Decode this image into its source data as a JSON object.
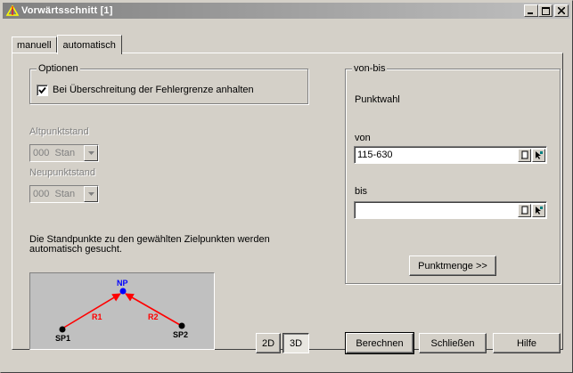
{
  "window": {
    "title": "Vorwärtsschnitt [1]"
  },
  "tabs": [
    {
      "label": "manuell",
      "active": false
    },
    {
      "label": "automatisch",
      "active": true
    }
  ],
  "optionen": {
    "legend": "Optionen",
    "checkbox_label": "Bei Überschreitung der Fehlergrenze anhalten",
    "checked": true
  },
  "altpunktstand": {
    "label": "Altpunktstand",
    "code": "000",
    "value": "Stan"
  },
  "neupunktstand": {
    "label": "Neupunktstand",
    "code": "000",
    "value": "Stan"
  },
  "info_text_line1": "Die Standpunkte zu den gewählten Zielpunkten werden",
  "info_text_line2": "automatisch gesucht.",
  "diagram": {
    "np": "NP",
    "r1": "R1",
    "r2": "R2",
    "sp1": "SP1",
    "sp2": "SP2",
    "colors": {
      "np": "#0000ff",
      "ray": "#ff0000",
      "point": "#000000",
      "bg": "#c0c0c0"
    }
  },
  "vonbis": {
    "legend": "von-bis",
    "punktwahl": "Punktwahl",
    "von_label": "von",
    "von_value": "115-630",
    "bis_label": "bis",
    "bis_value": "",
    "punktmenge_label": "Punktmenge >>"
  },
  "dim": {
    "two_d": "2D",
    "three_d": "3D",
    "active": "3D"
  },
  "footer": {
    "berechnen": "Berechnen",
    "schliessen": "Schließen",
    "hilfe": "Hilfe"
  }
}
